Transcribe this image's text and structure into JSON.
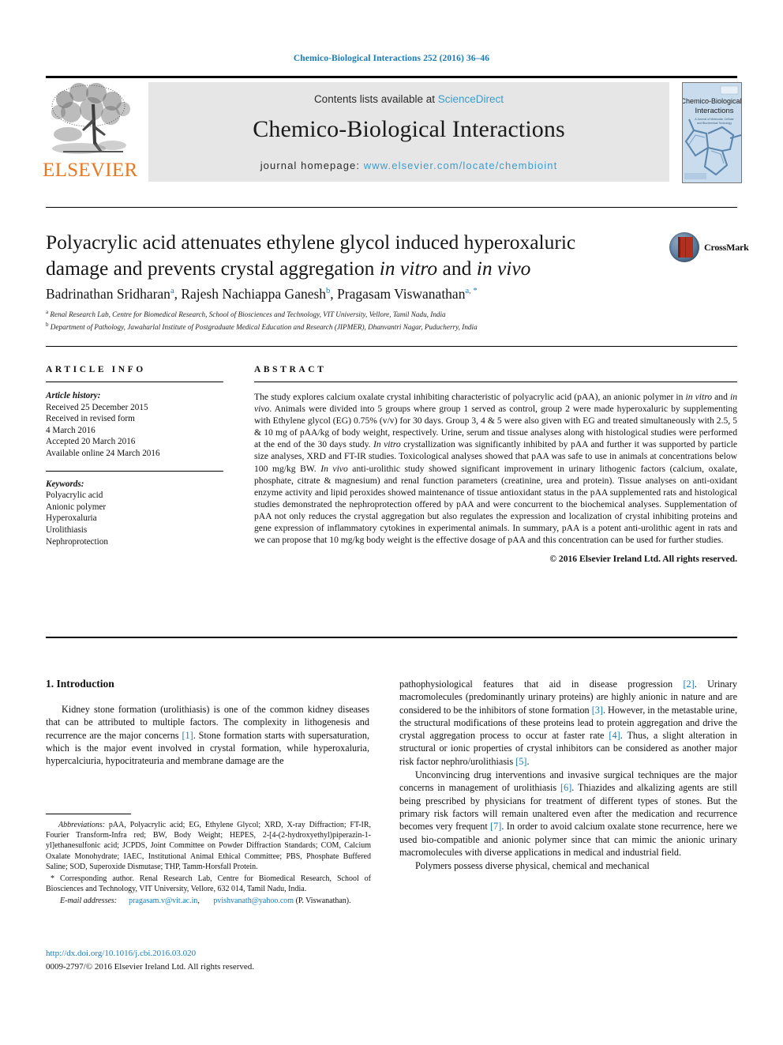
{
  "running_head": "Chemico-Biological Interactions 252 (2016) 36–46",
  "masthead": {
    "publisher_logo_text": "ELSEVIER",
    "contents_prefix": "Contents lists available at ",
    "contents_link": "ScienceDirect",
    "journal_title": "Chemico-Biological Interactions",
    "homepage_prefix": "journal homepage: ",
    "homepage_url": "www.elsevier.com/locate/chembioint",
    "cover_title_line1": "Chemico-Biological",
    "cover_title_line2": "Interactions"
  },
  "article": {
    "title_line1": "Polyacrylic acid attenuates ethylene glycol induced hyperoxaluric",
    "title_line2_a": "damage and prevents crystal aggregation ",
    "title_line2_it1": "in vitro",
    "title_line2_b": " and ",
    "title_line2_it2": "in vivo",
    "crossmark_label": "CrossMark",
    "authors": [
      {
        "name": "Badrinathan Sridharan",
        "marks": "a"
      },
      {
        "name": "Rajesh Nachiappa Ganesh",
        "marks": "b"
      },
      {
        "name": "Pragasam Viswanathan",
        "marks": "a, *"
      }
    ],
    "affiliations": [
      {
        "mark": "a",
        "text": "Renal Research Lab, Centre for Biomedical Research, School of Biosciences and Technology, VIT University, Vellore, Tamil Nadu, India"
      },
      {
        "mark": "b",
        "text": "Department of Pathology, Jawaharlal Institute of Postgraduate Medical Education and Research (JIPMER), Dhanvantri Nagar, Puducherry, India"
      }
    ]
  },
  "article_info": {
    "heading": "ARTICLE INFO",
    "history_label": "Article history:",
    "history": [
      "Received 25 December 2015",
      "Received in revised form",
      "4 March 2016",
      "Accepted 20 March 2016",
      "Available online 24 March 2016"
    ],
    "keywords_label": "Keywords:",
    "keywords": [
      "Polyacrylic acid",
      "Anionic polymer",
      "Hyperoxaluria",
      "Urolithiasis",
      "Nephroprotection"
    ]
  },
  "abstract": {
    "heading": "ABSTRACT",
    "p1": "The study explores calcium oxalate crystal inhibiting characteristic of polyacrylic acid (pAA), an anionic polymer in ",
    "it1": "in vitro",
    "p2": " and ",
    "it2": "in vivo",
    "p3": ". Animals were divided into 5 groups where group 1 served as control, group 2 were made hyperoxaluric by supplementing with Ethylene glycol (EG) 0.75% (v/v) for 30 days. Group 3, 4 & 5 were also given with EG and treated simultaneously with 2.5, 5 & 10 mg of pAA/kg of body weight, respectively. Urine, serum and tissue analyses along with histological studies were performed at the end of the 30 days study. ",
    "it3": "In vitro",
    "p4": " crystallization was significantly inhibited by pAA and further it was supported by particle size analyses, XRD and FT-IR studies. Toxicological analyses showed that pAA was safe to use in animals at concentrations below 100 mg/kg BW. ",
    "it4": "In vivo",
    "p5": " anti-urolithic study showed significant improvement in urinary lithogenic factors (calcium, oxalate, phosphate, citrate & magnesium) and renal function parameters (creatinine, urea and protein). Tissue analyses on anti-oxidant enzyme activity and lipid peroxides showed maintenance of tissue antioxidant status in the pAA supplemented rats and histological studies demonstrated the nephroprotection offered by pAA and were concurrent to the biochemical analyses. Supplementation of pAA not only reduces the crystal aggregation but also regulates the expression and localization of crystal inhibiting proteins and gene expression of inflammatory cytokines in experimental animals. In summary, pAA is a potent anti-urolithic agent in rats and we can propose that 10 mg/kg body weight is the effective dosage of pAA and this concentration can be used for further studies.",
    "copyright": "© 2016 Elsevier Ireland Ltd. All rights reserved."
  },
  "introduction": {
    "heading": "1. Introduction",
    "left_p1_a": "Kidney stone formation (urolithiasis) is one of the common kidney diseases that can be attributed to multiple factors. The complexity in lithogenesis and recurrence are the major concerns ",
    "left_p1_ref1": "[1]",
    "left_p1_b": ". Stone formation starts with supersaturation, which is the major event involved in crystal formation, while hyperoxaluria, hypercalciuria, hypocitrateuria and membrane damage are the",
    "right_p1_a": "pathophysiological features that aid in disease progression ",
    "right_p1_ref2": "[2]",
    "right_p1_b": ". Urinary macromolecules (predominantly urinary proteins) are highly anionic in nature and are considered to be the inhibitors of stone formation ",
    "right_p1_ref3": "[3]",
    "right_p1_c": ". However, in the metastable urine, the structural modifications of these proteins lead to protein aggregation and drive the crystal aggregation process to occur at faster rate ",
    "right_p1_ref4": "[4]",
    "right_p1_d": ". Thus, a slight alteration in structural or ionic properties of crystal inhibitors can be considered as another major risk factor nephro/urolithiasis ",
    "right_p1_ref5": "[5]",
    "right_p1_e": ".",
    "right_p2_a": "Unconvincing drug interventions and invasive surgical techniques are the major concerns in management of urolithiasis ",
    "right_p2_ref6": "[6]",
    "right_p2_b": ". Thiazides and alkalizing agents are still being prescribed by physicians for treatment of different types of stones. But the primary risk factors will remain unaltered even after the medication and recurrence becomes very frequent ",
    "right_p2_ref7": "[7]",
    "right_p2_c": ". In order to avoid calcium oxalate stone recurrence, here we used bio-compatible and anionic polymer since that can mimic the anionic urinary macromolecules with diverse applications in medical and industrial field.",
    "right_p3": "Polymers possess diverse physical, chemical and mechanical"
  },
  "footnotes": {
    "abbrev_label": "Abbreviations:",
    "abbrev_text": " pAA, Polyacrylic acid; EG, Ethylene Glycol; XRD, X-ray Diffraction; FT-IR, Fourier Transform-Infra red; BW, Body Weight; HEPES, 2-[4-(2-hydroxyethyl)piperazin-1-yl]ethanesulfonic acid; JCPDS, Joint Committee on Powder Diffraction Standards; COM, Calcium Oxalate Monohydrate; IAEC, Institutional Animal Ethical Committee; PBS, Phosphate Buffered Saline; SOD, Superoxide Dismutase; THP, Tamm-Horsfall Protein.",
    "corresponding_marker": "*",
    "corresponding_text": " Corresponding author. Renal Research Lab, Centre for Biomedical Research, School of Biosciences and Technology, VIT University, Vellore, 632 014, Tamil Nadu, India.",
    "email_label": "E-mail addresses:",
    "email_1": "pragasam.v@vit.ac.in",
    "email_sep": ", ",
    "email_2": "pvishvanath@yahoo.com",
    "email_attrib": "(P. Viswanathan).",
    "doi": "http://dx.doi.org/10.1016/j.cbi.2016.03.020",
    "issn_copyright": "0009-2797/© 2016 Elsevier Ireland Ltd. All rights reserved."
  },
  "colors": {
    "link_blue": "#1a7bb9",
    "sciencedirect_blue": "#3d9ccc",
    "elsevier_orange": "#E87722",
    "panel_grey": "#e6e6e6"
  }
}
